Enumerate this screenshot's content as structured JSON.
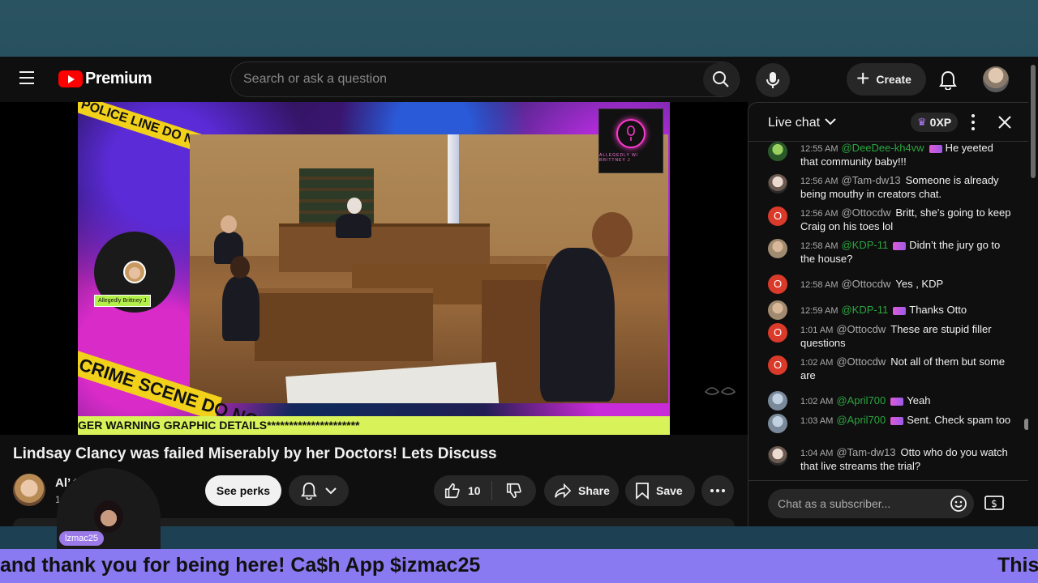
{
  "topbar": {
    "logo_text": "Premium",
    "search_placeholder": "Search or ask a question",
    "create_label": "Create"
  },
  "video": {
    "tape_top": "POLICE LINE DO NOT CROSS",
    "tape_bottom": "CRIME SCENE DO NOT",
    "ticker": "GER WARNING GRAPHIC DETAILS*********************",
    "cam_tag": "Allegedly Brittney J",
    "logo_small_text": "ALLEGEDLY W/ BRITTNEY J"
  },
  "details": {
    "title": "Lindsay Clancy was failed Miserably by her Doctors! Lets Discuss",
    "channel_name": "Allegedly Brittney J",
    "channel_name_visible": "Al’              ttney J",
    "channel_subs": "1",
    "perks_label": "See perks",
    "like_count": "10",
    "share_label": "Share",
    "save_label": "Save"
  },
  "chat": {
    "title": "Live chat",
    "xp": "0XP",
    "input_placeholder": "Chat as a subscriber...",
    "messages": [
      {
        "time": "12:55 AM",
        "author": "@DeeDee-kh4vw",
        "text": "He yeeted that community baby!!!",
        "member": true
      },
      {
        "time": "12:56 AM",
        "author": "@Tam-dw13",
        "text": "Someone is already being mouthy in creators chat.",
        "member": false
      },
      {
        "time": "12:56 AM",
        "author": "@Ottocdw",
        "text": "Britt, she’s going to keep Craig on his toes lol",
        "member": false
      },
      {
        "time": "12:58 AM",
        "author": "@KDP-11",
        "text": "Didn’t the jury go to the house?",
        "member": true
      },
      {
        "time": "12:58 AM",
        "author": "@Ottocdw",
        "text": "Yes , KDP",
        "member": false
      },
      {
        "time": "12:59 AM",
        "author": "@KDP-11",
        "text": "Thanks Otto",
        "member": true
      },
      {
        "time": "1:01 AM",
        "author": "@Ottocdw",
        "text": "These are stupid filler questions",
        "member": false
      },
      {
        "time": "1:02 AM",
        "author": "@Ottocdw",
        "text": "Not all of them but some are",
        "member": false
      },
      {
        "time": "1:02 AM",
        "author": "@April700",
        "text": "Yeah",
        "member": true
      },
      {
        "time": "1:03 AM",
        "author": "@April700",
        "text": "Sent. Check spam too",
        "member": true
      },
      {
        "time": "1:04 AM",
        "author": "@Tam-dw13",
        "text": "Otto who do you watch that live streams the trial?",
        "member": false
      }
    ],
    "avatar_letter": "O"
  },
  "overlay": {
    "webcam_tag": "lzmac25",
    "marquee_main": "and thank you for being here! Ca$h App $izmac25",
    "marquee_next": "This"
  },
  "colors": {
    "accent_red": "#ff0000",
    "member_green": "#2ba640",
    "marquee_purple": "#8a7af2",
    "ticker_yellow": "#d8f25a"
  }
}
